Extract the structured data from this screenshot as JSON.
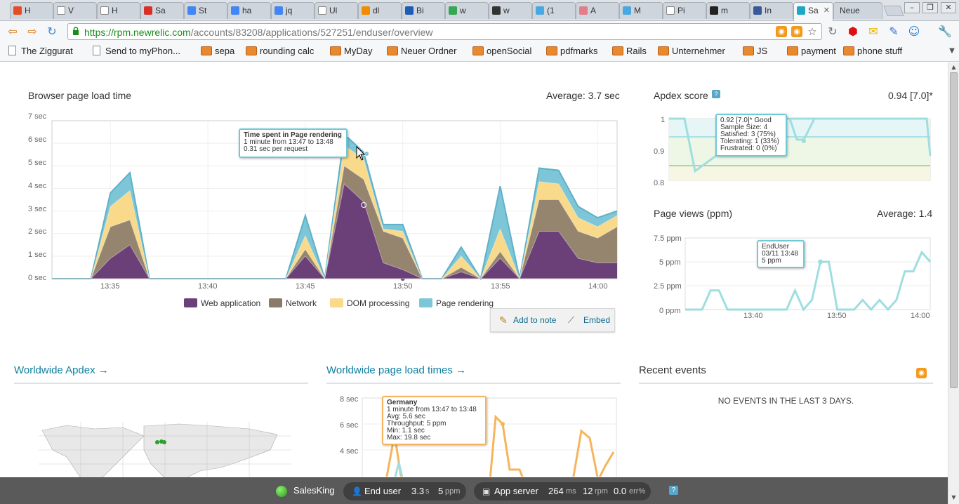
{
  "browser": {
    "tabs": [
      {
        "label": "H",
        "favicon": "html5-icon",
        "color": "#e44d26"
      },
      {
        "label": "V",
        "favicon": "page-icon",
        "color": "#ffffff"
      },
      {
        "label": "H",
        "favicon": "page-icon",
        "color": "#ffffff"
      },
      {
        "label": "Sa",
        "favicon": "gmail-icon",
        "color": "#d93025"
      },
      {
        "label": "St",
        "favicon": "docs-icon",
        "color": "#4285f4"
      },
      {
        "label": "ha",
        "favicon": "docs-icon",
        "color": "#4285f4"
      },
      {
        "label": "jq",
        "favicon": "google-icon",
        "color": "#4285f4"
      },
      {
        "label": "Ul",
        "favicon": "page-icon",
        "color": "#ffffff"
      },
      {
        "label": "dl",
        "favicon": "dailymotion-icon",
        "color": "#f08c00"
      },
      {
        "label": "Bi",
        "favicon": "b-icon",
        "color": "#1e5cb3"
      },
      {
        "label": "w",
        "favicon": "google-icon",
        "color": "#34a853"
      },
      {
        "label": "w",
        "favicon": "wiki-icon",
        "color": "#333333"
      },
      {
        "label": "(1",
        "favicon": "twitter-icon",
        "color": "#4aa8e0"
      },
      {
        "label": "A",
        "favicon": "heart-icon",
        "color": "#e27d8a"
      },
      {
        "label": "M",
        "favicon": "twitter-icon",
        "color": "#4aa8e0"
      },
      {
        "label": "Pi",
        "favicon": "page-icon",
        "color": "#ffffff"
      },
      {
        "label": "m",
        "favicon": "github-icon",
        "color": "#222222"
      },
      {
        "label": "In",
        "favicon": "facebook-icon",
        "color": "#3b5998"
      },
      {
        "label": "Sa",
        "favicon": "newrelic-icon",
        "color": "#1ea7c5",
        "active": true
      },
      {
        "label": "Neue",
        "favicon": "",
        "color": ""
      }
    ],
    "url_host": "https://rpm.newrelic.com",
    "url_path": "/accounts/83208/applications/527251/enduser/overview",
    "bookmarks": [
      {
        "label": "The Ziggurat",
        "type": "page"
      },
      {
        "label": "Send to myPhon...",
        "type": "page"
      },
      {
        "label": "sepa",
        "type": "folder"
      },
      {
        "label": "rounding calc",
        "type": "folder"
      },
      {
        "label": "MyDay",
        "type": "folder"
      },
      {
        "label": "Neuer Ordner",
        "type": "folder"
      },
      {
        "label": "openSocial",
        "type": "folder"
      },
      {
        "label": "pdfmarks",
        "type": "folder"
      },
      {
        "label": "Rails",
        "type": "folder"
      },
      {
        "label": "Unternehmer",
        "type": "folder"
      },
      {
        "label": "JS",
        "type": "folder"
      },
      {
        "label": "payment",
        "type": "folder"
      },
      {
        "label": "phone stuff",
        "type": "folder"
      }
    ]
  },
  "load_chart": {
    "title": "Browser page load time",
    "average": "Average: 3.7 sec",
    "y_ticks": [
      "0 sec",
      "1 sec",
      "2 sec",
      "3 sec",
      "4 sec",
      "5 sec",
      "6 sec",
      "7 sec"
    ],
    "x_ticks": [
      "13:35",
      "13:40",
      "13:45",
      "13:50",
      "13:55",
      "14:00"
    ],
    "legend": [
      "Web application",
      "Network",
      "DOM processing",
      "Page rendering"
    ],
    "tooltip": {
      "title": "Time spent in Page rendering",
      "line1": "1 minute from 13:47 to 13:48",
      "line2": "0.31 sec per request"
    },
    "add_to_note": "Add to note",
    "embed": "Embed"
  },
  "apdex": {
    "title": "Apdex score",
    "help": "?",
    "score": "0.94 [7.0]*",
    "y_ticks": [
      "1",
      "0.9",
      "0.8"
    ],
    "tooltip": [
      "0.92 [7.0]* Good",
      "Sample Size: 4",
      "Satisfied: 3 (75%)",
      "Tolerating: 1 (33%)",
      "Frustrated: 0 (0%)"
    ]
  },
  "pageviews": {
    "title": "Page views (ppm)",
    "average": "Average: 1.4",
    "y_ticks": [
      "7.5 ppm",
      "5 ppm",
      "2.5 ppm",
      "0 ppm"
    ],
    "x_ticks": [
      "13:40",
      "13:50",
      "14:00"
    ],
    "tooltip": [
      "EndUser",
      "03/11 13:48",
      "5 ppm"
    ]
  },
  "sections": {
    "worldwide_apdex": "Worldwide Apdex →",
    "worldwide_load": "Worldwide page load times →",
    "recent_events": "Recent events",
    "no_events": "NO EVENTS IN THE LAST 3 DAYS."
  },
  "worldwide_load_chart": {
    "y_ticks": [
      "8 sec",
      "6 sec",
      "4 sec"
    ],
    "tooltip": {
      "title": "Germany",
      "lines": [
        "1 minute from 13:47 to 13:48",
        "Avg: 5.6 sec",
        "Throughput: 5 ppm",
        "Min: 1.1 sec",
        "Max: 19.8 sec"
      ]
    }
  },
  "footer": {
    "app_name": "SalesKing",
    "end_user_label": "End user",
    "end_user_time": "3.3",
    "end_user_time_unit": "s",
    "end_user_rpm": "5",
    "end_user_rpm_unit": "ppm",
    "app_server_label": "App server",
    "app_server_time": "264",
    "app_server_time_unit": "ms",
    "app_server_rpm": "12",
    "app_server_rpm_unit": "rpm",
    "app_server_err": "0.0",
    "app_server_err_unit": "err%",
    "help": "?"
  },
  "colors": {
    "web_app": "#6b3f78",
    "network": "#8a7a6a",
    "dom": "#f9d98a",
    "render": "#7dc6d8",
    "teal_line": "#9fdedf",
    "orange_line": "#f5b55c"
  },
  "chart_data": [
    {
      "type": "area",
      "title": "Browser page load time",
      "ylabel": "sec",
      "ylim": [
        0,
        7
      ],
      "x": [
        "13:32",
        "13:33",
        "13:34",
        "13:35",
        "13:36",
        "13:37",
        "13:38",
        "13:39",
        "13:40",
        "13:41",
        "13:42",
        "13:43",
        "13:44",
        "13:45",
        "13:46",
        "13:47",
        "13:48",
        "13:49",
        "13:50",
        "13:51",
        "13:52",
        "13:53",
        "13:54",
        "13:55",
        "13:56",
        "13:57",
        "13:58",
        "13:59",
        "14:00",
        "14:01"
      ],
      "series": [
        {
          "name": "Web application",
          "values": [
            0,
            0,
            0,
            0.9,
            1.5,
            0,
            0,
            0,
            0,
            0,
            0,
            0,
            0,
            1.0,
            0,
            4.2,
            3.4,
            0.7,
            0.4,
            0,
            0,
            0.3,
            0,
            0.9,
            0,
            2.1,
            2.1,
            0.9,
            0.7,
            0.7
          ]
        },
        {
          "name": "Network",
          "values": [
            0,
            0,
            0,
            1.4,
            1.1,
            0,
            0,
            0,
            0,
            0,
            0,
            0,
            0,
            0.3,
            0,
            0.8,
            1.0,
            1.4,
            1.4,
            0,
            0,
            0.2,
            0,
            0.3,
            0,
            1.4,
            1.4,
            1.2,
            1.1,
            1.6
          ]
        },
        {
          "name": "DOM processing",
          "values": [
            0,
            0,
            0,
            0.9,
            1.3,
            0,
            0,
            0,
            0,
            0,
            0,
            0,
            0,
            0.6,
            0,
            0.9,
            0.9,
            0.1,
            0.3,
            0,
            0,
            0.5,
            0,
            1.0,
            0,
            0.8,
            0.7,
            0.6,
            0.5,
            0.5
          ]
        },
        {
          "name": "Page rendering",
          "values": [
            0,
            0,
            0,
            0.6,
            0.8,
            0,
            0,
            0,
            0,
            0,
            0,
            0,
            0,
            0.9,
            0,
            0.5,
            0.3,
            0.2,
            0.3,
            0,
            0,
            0.4,
            0,
            1.9,
            0,
            0.6,
            0.6,
            0.5,
            0.4,
            0.2
          ]
        }
      ]
    },
    {
      "type": "line",
      "title": "Apdex score",
      "ylim": [
        0.8,
        1
      ],
      "x": [
        "13:32",
        "13:33",
        "13:35",
        "13:37",
        "13:40",
        "13:42",
        "13:46",
        "13:47",
        "13:48",
        "13:49",
        "13:50",
        "13:55",
        "14:00",
        "14:01"
      ],
      "series": [
        {
          "values": [
            1,
            1,
            0.83,
            0.88,
            1,
            1,
            1,
            1,
            1,
            1,
            1,
            1,
            1,
            0.88
          ]
        }
      ]
    },
    {
      "type": "line",
      "title": "Page views (ppm)",
      "ylabel": "ppm",
      "ylim": [
        0,
        7.5
      ],
      "x": [
        "13:32",
        "13:33",
        "13:34",
        "13:35",
        "13:36",
        "13:37",
        "13:38",
        "13:39",
        "13:40",
        "13:41",
        "13:42",
        "13:43",
        "13:44",
        "13:45",
        "13:46",
        "13:47",
        "13:48",
        "13:49",
        "13:50",
        "13:51",
        "13:52",
        "13:53",
        "13:54",
        "13:55",
        "13:56",
        "13:57",
        "13:58",
        "13:59",
        "14:00",
        "14:01"
      ],
      "series": [
        {
          "name": "EndUser",
          "values": [
            0,
            0,
            0,
            2,
            2,
            0,
            0,
            0,
            0,
            0,
            0,
            0,
            0,
            2,
            0,
            1,
            5,
            5,
            0,
            0,
            0,
            1,
            0,
            1,
            0,
            1,
            4,
            4,
            6,
            5
          ]
        }
      ]
    }
  ]
}
